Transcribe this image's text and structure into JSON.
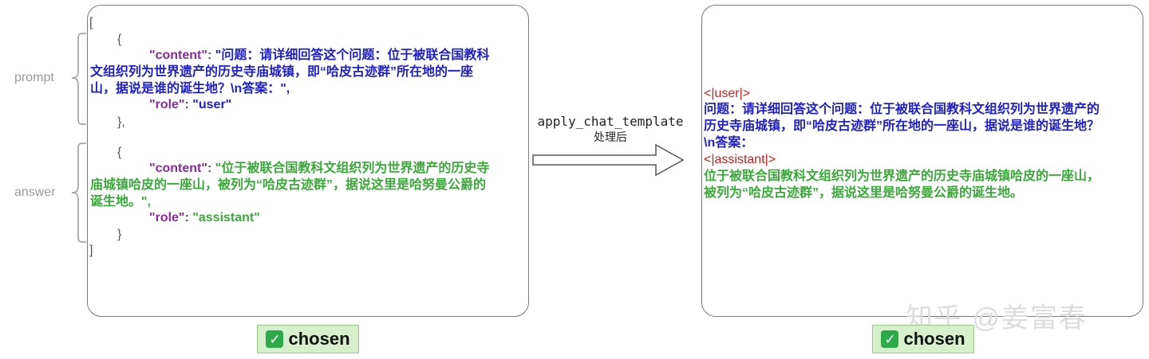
{
  "left": {
    "open_bracket": "[",
    "open_brace_1": "{",
    "content_key": "\"content\"",
    "sep": ":",
    "prompt_value_lines": [
      "\"问题：请详细回答这个问题：位于被联合国教科",
      "文组织列为世界遗产的历史寺庙城镇，即“哈皮古迹群”所在地的一座",
      "山，据说是谁的诞生地？\\n答案：\","
    ],
    "role_key": "\"role\"",
    "role_user": "\"user\"",
    "close_brace_1": "},",
    "open_brace_2": "{",
    "answer_value_lines": [
      "\"位于被联合国教科文组织列为世界遗产的历史寺",
      "庙城镇哈皮的一座山，被列为“哈皮古迹群”，据说这里是哈努曼公爵的",
      "诞生地。\","
    ],
    "role_assistant": "\"assistant\"",
    "close_brace_2": "}",
    "close_bracket": "]"
  },
  "labels": {
    "prompt": "prompt",
    "answer": "answer"
  },
  "arrow": {
    "label": "apply_chat_template",
    "sub": "处理后"
  },
  "right": {
    "user_tag": "<|user|>",
    "question_lines": [
      "问题：请详细回答这个问题：位于被联合国教科文组织列为世界遗产的",
      "历史寺庙城镇，即“哈皮古迹群”所在地的一座山，据说是谁的诞生地？",
      "\\n答案："
    ],
    "assistant_tag": "<|assistant|>",
    "answer_lines": [
      "位于被联合国教科文组织列为世界遗产的历史寺庙城镇哈皮的一座山，",
      "被列为“哈皮古迹群”，据说这里是哈努曼公爵的诞生地。"
    ]
  },
  "badges": {
    "left": "chosen",
    "right": "chosen"
  },
  "watermark": "知乎 @姜富春",
  "colors": {
    "prompt_text": "#1f1fc8",
    "answer_text": "#3aa83a",
    "key_text": "#8a2a9c",
    "tag_text": "#c42020",
    "badge_bg": "#d6f0cc"
  }
}
